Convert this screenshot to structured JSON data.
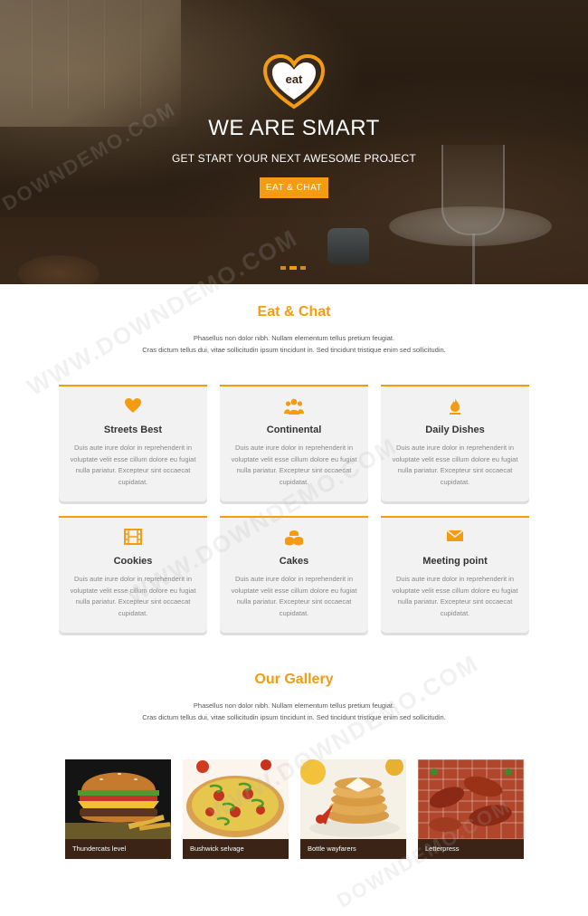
{
  "hero": {
    "logo_text": "eat",
    "title": "WE ARE SMART",
    "subtitle": "GET START YOUR NEXT AWESOME PROJECT",
    "button_label": "EAT & CHAT",
    "slides": 3,
    "active_slide": 2
  },
  "eat_chat": {
    "title": "Eat & Chat",
    "desc_line1": "Phasellus non dolor nibh. Nullam elementum tellus pretium feugiat.",
    "desc_line2": "Cras dictum tellus dui, vitae sollicitudin ipsum tincidunt in. Sed tincidunt tristique enim sed sollicitudin."
  },
  "features": [
    {
      "icon": "heart-icon",
      "title": "Streets Best",
      "text": "Duis aute irure dolor in reprehenderit in voluptate velit esse cillum dolore eu fugiat nulla pariatur. Excepteur sint occaecat cupidatat."
    },
    {
      "icon": "group-icon",
      "title": "Continental",
      "text": "Duis aute irure dolor in reprehenderit in voluptate velit esse cillum dolore eu fugiat nulla pariatur. Excepteur sint occaecat cupidatat."
    },
    {
      "icon": "fire-icon",
      "title": "Daily Dishes",
      "text": "Duis aute irure dolor in reprehenderit in voluptate velit esse cillum dolore eu fugiat nulla pariatur. Excepteur sint occaecat cupidatat."
    },
    {
      "icon": "film-icon",
      "title": "Cookies",
      "text": "Duis aute irure dolor in reprehenderit in voluptate velit esse cillum dolore eu fugiat nulla pariatur. Excepteur sint occaecat cupidatat."
    },
    {
      "icon": "coins-icon",
      "title": "Cakes",
      "text": "Duis aute irure dolor in reprehenderit in voluptate velit esse cillum dolore eu fugiat nulla pariatur. Excepteur sint occaecat cupidatat."
    },
    {
      "icon": "envelope-icon",
      "title": "Meeting point",
      "text": "Duis aute irure dolor in reprehenderit in voluptate velit esse cillum dolore eu fugiat nulla pariatur. Excepteur sint occaecat cupidatat."
    }
  ],
  "gallery": {
    "title": "Our Gallery",
    "desc_line1": "Phasellus non dolor nibh. Nullam elementum tellus pretium feugiat.",
    "desc_line2": "Cras dictum tellus dui, vitae sollicitudin ipsum tincidunt in. Sed tincidunt tristique enim sed sollicitudin.",
    "items": [
      {
        "caption": "Thundercats level",
        "image": "burger-image"
      },
      {
        "caption": "Bushwick selvage",
        "image": "pizza-image"
      },
      {
        "caption": "Bottle wayfarers",
        "image": "pancakes-image"
      },
      {
        "caption": "Letterpress",
        "image": "grilled-chicken-image"
      }
    ]
  },
  "watermark": {
    "text": "WWW.DOWNDEMO.COM",
    "short_text": "DOWNDEMO.COM"
  },
  "colors": {
    "accent": "#f39c12",
    "card_bg": "#f2f2f2",
    "caption_bg": "#3b2416",
    "heading": "#333333"
  }
}
